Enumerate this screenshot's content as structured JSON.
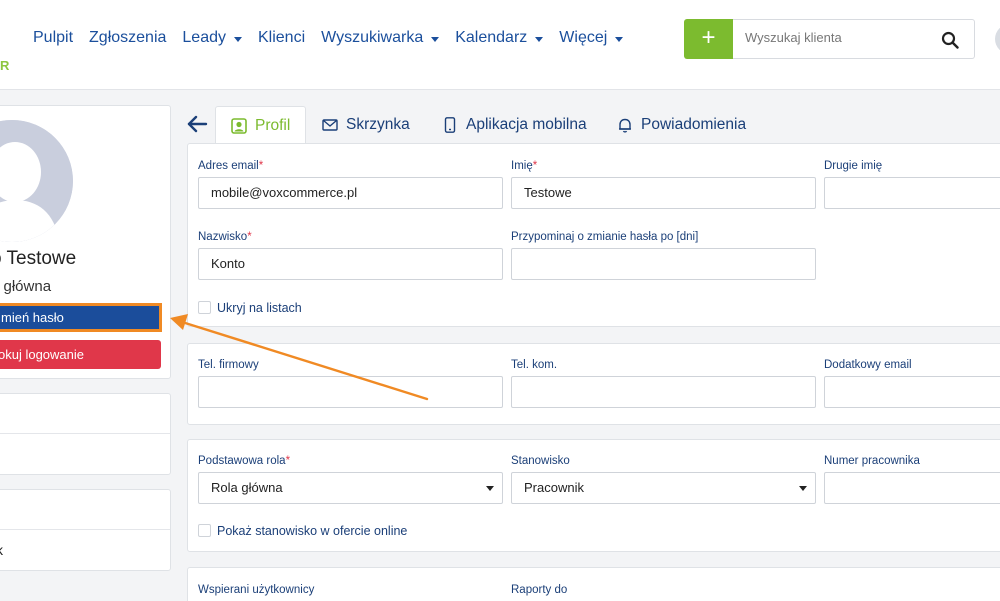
{
  "logo": {
    "fragment": "R"
  },
  "nav": {
    "items": [
      {
        "label": "Pulpit",
        "dropdown": false
      },
      {
        "label": "Zgłoszenia",
        "dropdown": false
      },
      {
        "label": "Leady",
        "dropdown": true
      },
      {
        "label": "Klienci",
        "dropdown": false
      },
      {
        "label": "Wyszukiwarka",
        "dropdown": true
      },
      {
        "label": "Kalendarz",
        "dropdown": true
      },
      {
        "label": "Więcej",
        "dropdown": true
      }
    ]
  },
  "search": {
    "placeholder": "Wyszukaj klienta",
    "add_label": "+"
  },
  "profile": {
    "name": "o Testowe",
    "role": "a główna",
    "change_password": "mień hasło",
    "block_login": "okuj logowanie"
  },
  "side_boxes": [
    {
      "rows": [
        "",
        ""
      ]
    },
    {
      "rows": [
        "",
        "k"
      ]
    }
  ],
  "tabs": [
    {
      "label": "Profil",
      "icon": "user-icon",
      "active": true
    },
    {
      "label": "Skrzynka",
      "icon": "envelope-icon",
      "active": false
    },
    {
      "label": "Aplikacja mobilna",
      "icon": "mobile-icon",
      "active": false
    },
    {
      "label": "Powiadomienia",
      "icon": "bell-icon",
      "active": false
    }
  ],
  "form": {
    "email_label": "Adres email",
    "email_value": "mobile@voxcommerce.pl",
    "first_name_label": "Imię",
    "first_name_value": "Testowe",
    "middle_name_label": "Drugie imię",
    "middle_name_value": "",
    "last_name_label": "Nazwisko",
    "last_name_value": "Konto",
    "password_reminder_label": "Przypominaj o zmianie hasła po [dni]",
    "password_reminder_value": "",
    "hide_on_lists_label": "Ukryj na listach",
    "company_phone_label": "Tel. firmowy",
    "mobile_phone_label": "Tel. kom.",
    "extra_email_label": "Dodatkowy email",
    "base_role_label": "Podstawowa rola",
    "base_role_value": "Rola główna",
    "position_label": "Stanowisko",
    "position_value": "Pracownik",
    "employee_number_label": "Numer pracownika",
    "show_position_label": "Pokaż stanowisko w ofercie online",
    "supported_users_label": "Wspierani użytkownicy",
    "reports_to_label": "Raporty do"
  },
  "colors": {
    "accent_green": "#7cbb2f",
    "nav_blue": "#1b4f9c",
    "danger_red": "#e0374a",
    "highlight_orange": "#f08a24"
  }
}
